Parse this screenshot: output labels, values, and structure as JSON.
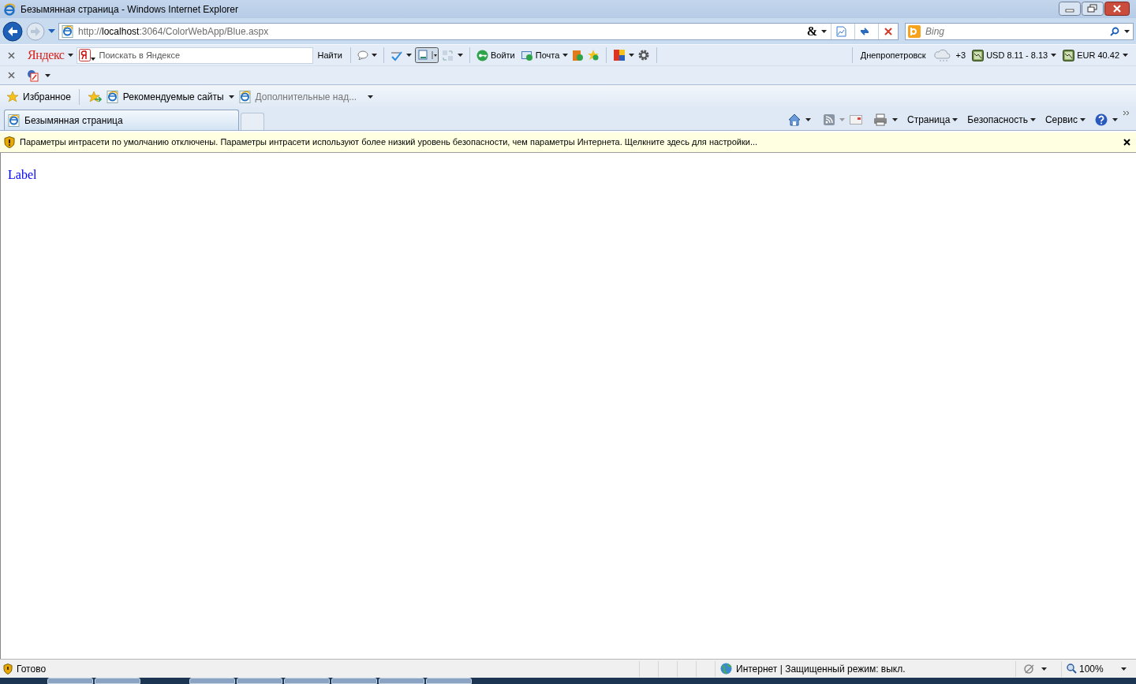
{
  "window": {
    "title": "Безымянная страница - Windows Internet Explorer"
  },
  "address_bar": {
    "url": "http://**localhost**:3064/ColorWebApp/Blue.aspx",
    "compat_glyph": "&"
  },
  "search_box": {
    "placeholder": "Bing"
  },
  "yandex_bar": {
    "logo": "Яндекс",
    "search_placeholder": "Поискать в Яндексе",
    "find_button": "Найти",
    "login": "Войти",
    "mail": "Почта",
    "city": "Днепропетровск",
    "weather": "+3",
    "rates": [
      "USD 8.11 - 8.13",
      "EUR 40.42"
    ]
  },
  "favorites_bar": {
    "favorites": "Избранное",
    "items": [
      {
        "label": "Рекомендуемые сайты",
        "disabled": false
      },
      {
        "label": "Дополнительные над...",
        "disabled": true
      }
    ]
  },
  "tabs": [
    {
      "label": "Безымянная страница",
      "selected": true
    }
  ],
  "command_bar": {
    "menus": [
      "Страница",
      "Безопасность",
      "Сервис"
    ]
  },
  "info_bar": {
    "message": "Параметры интрасети по умолчанию отключены. Параметры интрасети используют более низкий уровень безопасности, чем параметры Интернета. Щелкните здесь для настройки..."
  },
  "page": {
    "label": "Label"
  },
  "status_bar": {
    "status": "Готово",
    "zone": "Интернет | Защищенный режим: выкл.",
    "zoom": "100%"
  }
}
